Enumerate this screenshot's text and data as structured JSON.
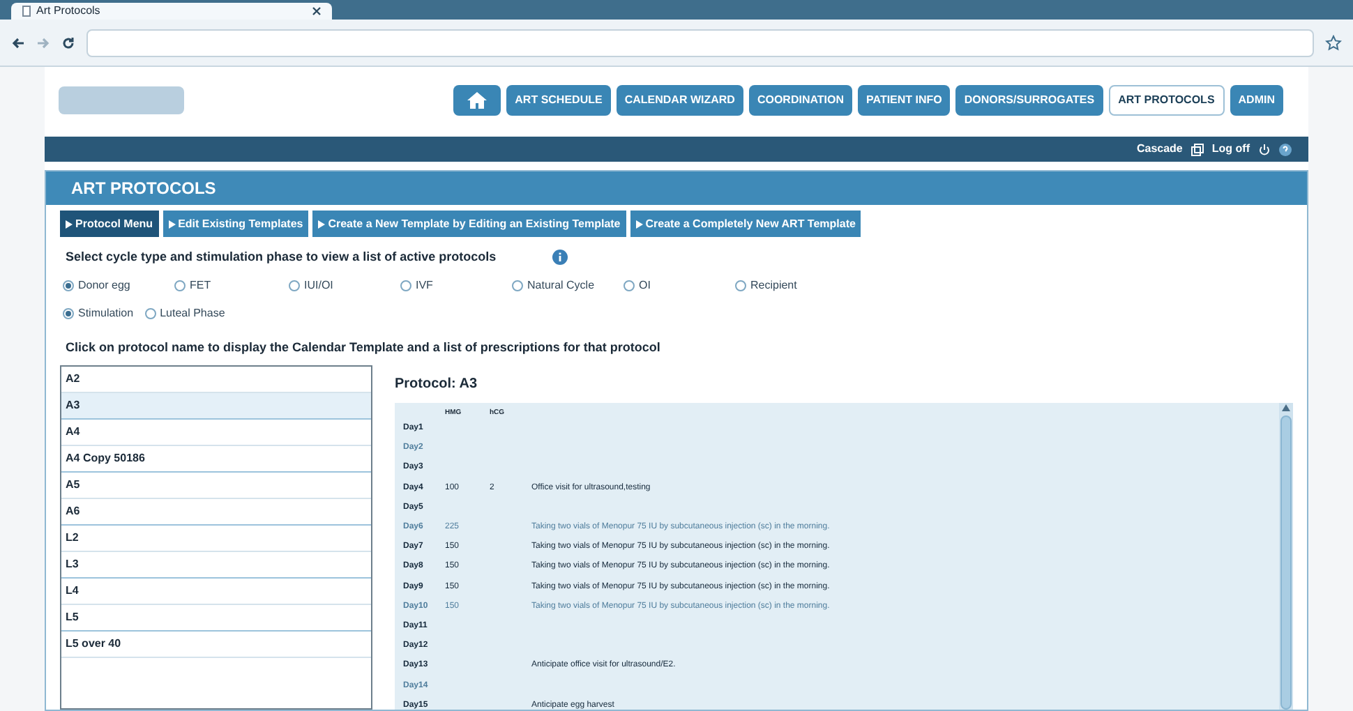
{
  "browser": {
    "tab_title": "Art Protocols"
  },
  "nav": [
    {
      "kind": "home",
      "selected": false
    },
    {
      "kind": "text",
      "label": "ART SCHEDULE",
      "selected": false
    },
    {
      "kind": "text",
      "label": "CALENDAR WIZARD",
      "selected": false
    },
    {
      "kind": "text",
      "label": "COORDINATION",
      "selected": false
    },
    {
      "kind": "text",
      "label": "PATIENT INFO",
      "selected": false
    },
    {
      "kind": "text",
      "label": "DONORS/SURROGATES",
      "selected": false
    },
    {
      "kind": "text",
      "label": "ART PROTOCOLS",
      "selected": true
    },
    {
      "kind": "text",
      "label": "ADMIN",
      "selected": false
    }
  ],
  "user_bar": {
    "cascade": "Cascade",
    "logoff": "Log off"
  },
  "section_title": "ART PROTOCOLS",
  "subtabs": [
    {
      "label": "Protocol Menu",
      "selected": true
    },
    {
      "label": "Edit Existing Templates",
      "selected": false
    },
    {
      "label": "Create a New Template by Editing an Existing Template",
      "selected": false
    },
    {
      "label": "Create a Completely New ART Template",
      "selected": false
    }
  ],
  "cycle_prompt": "Select cycle type and stimulation phase to view a list of active protocols",
  "cycle_types": [
    {
      "label": "Donor egg",
      "selected": true
    },
    {
      "label": "FET",
      "selected": false
    },
    {
      "label": "IUI/OI",
      "selected": false
    },
    {
      "label": "IVF",
      "selected": false
    },
    {
      "label": "Natural Cycle",
      "selected": false
    },
    {
      "label": "OI",
      "selected": false
    },
    {
      "label": "Recipient",
      "selected": false
    }
  ],
  "phases": [
    {
      "label": "Stimulation",
      "selected": true
    },
    {
      "label": "Luteal Phase",
      "selected": false
    }
  ],
  "list_prompt": "Click on protocol name to display the Calendar Template and a list of prescriptions for that protocol",
  "protocols": [
    {
      "name": "A2",
      "selected": false
    },
    {
      "name": "A3",
      "selected": true
    },
    {
      "name": "A4",
      "selected": false
    },
    {
      "name": "A4 Copy 50186",
      "selected": false
    },
    {
      "name": "A5",
      "selected": false
    },
    {
      "name": "A6",
      "selected": false
    },
    {
      "name": "L2",
      "selected": false
    },
    {
      "name": "L3",
      "selected": false
    },
    {
      "name": "L4",
      "selected": false
    },
    {
      "name": "L5",
      "selected": false
    },
    {
      "name": "L5 over 40",
      "selected": false
    }
  ],
  "protocol_title": "Protocol: A3",
  "columns": [
    "HMG",
    "hCG"
  ],
  "days": [
    {
      "day": "Day1",
      "faded": false
    },
    {
      "day": "Day2",
      "faded": true
    },
    {
      "day": "Day3",
      "faded": false
    },
    {
      "day": "Day4",
      "c1": "100",
      "c2": "2",
      "note": "Office visit for ultrasound,testing",
      "faded": false
    },
    {
      "day": "Day5",
      "faded": false
    },
    {
      "day": "Day6",
      "c1": "225",
      "note": "Taking two vials of Menopur 75 IU by subcutaneous injection (sc) in the morning.",
      "faded": true
    },
    {
      "day": "Day7",
      "c1": "150",
      "note": "Taking two vials of Menopur 75 IU by subcutaneous injection (sc) in the morning.",
      "faded": false
    },
    {
      "day": "Day8",
      "c1": "150",
      "note": "Taking two vials of Menopur 75 IU by subcutaneous injection (sc) in the morning.",
      "faded": false
    },
    {
      "day": "Day9",
      "c1": "150",
      "note": "Taking two vials of Menopur 75 IU by subcutaneous injection (sc) in the morning.",
      "faded": false
    },
    {
      "day": "Day10",
      "c1": "150",
      "note": "Taking two vials of Menopur 75 IU by subcutaneous injection (sc) in the morning.",
      "faded": true
    },
    {
      "day": "Day11",
      "faded": false
    },
    {
      "day": "Day12",
      "faded": false
    },
    {
      "day": "Day13",
      "note": "Anticipate office visit for ultrasound/E2.",
      "faded": false
    },
    {
      "day": "Day14",
      "faded": true
    },
    {
      "day": "Day15",
      "note": "Anticipate egg harvest",
      "faded": false
    }
  ]
}
